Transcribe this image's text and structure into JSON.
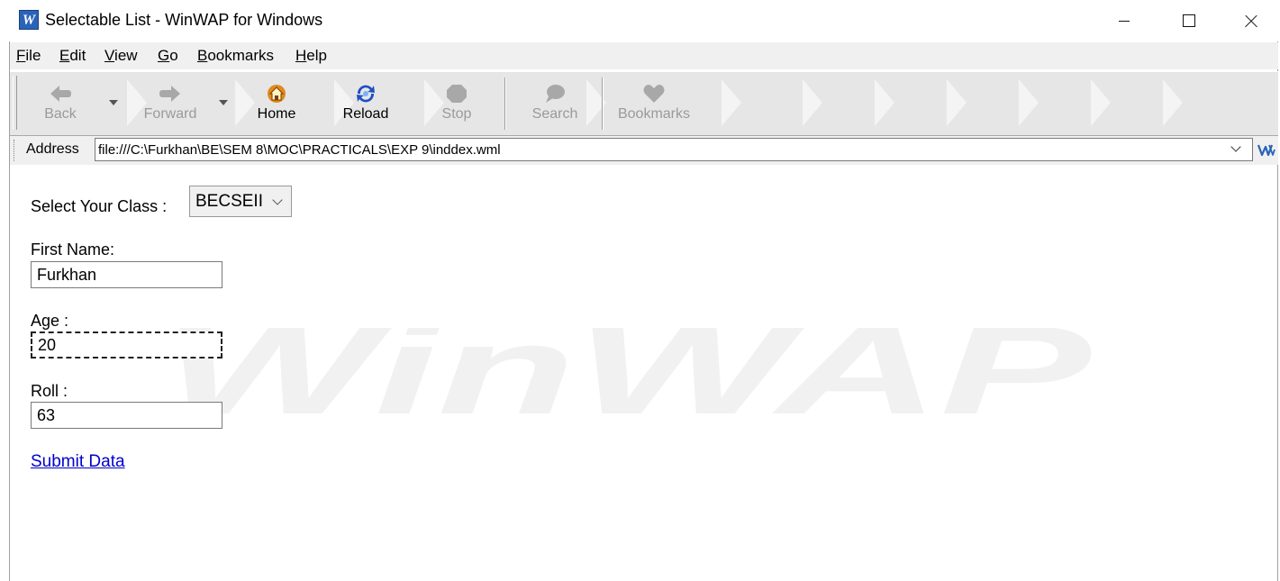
{
  "window": {
    "title": "Selectable List - WinWAP for Windows",
    "icon_letter": "W"
  },
  "menu": [
    {
      "label": "File",
      "key": "F",
      "rest": "ile"
    },
    {
      "label": "Edit",
      "key": "E",
      "rest": "dit"
    },
    {
      "label": "View",
      "key": "V",
      "rest": "iew"
    },
    {
      "label": "Go",
      "key": "G",
      "rest": "o"
    },
    {
      "label": "Bookmarks",
      "key": "B",
      "rest": "ookmarks"
    },
    {
      "label": "Help",
      "key": "H",
      "rest": "elp"
    }
  ],
  "toolbar": {
    "back": "Back",
    "forward": "Forward",
    "home": "Home",
    "reload": "Reload",
    "stop": "Stop",
    "search": "Search",
    "bookmarks": "Bookmarks"
  },
  "address": {
    "label": "Address",
    "value": "file:///C:\\Furkhan\\BE\\SEM 8\\MOC\\PRACTICALS\\EXP 9\\inddex.wml"
  },
  "form": {
    "class_label": "Select Your Class :",
    "class_value": "BECSEII",
    "first_name_label": "First Name:",
    "first_name_value": "Furkhan",
    "age_label": "Age :",
    "age_value": "20",
    "roll_label": "Roll :",
    "roll_value": "63",
    "submit_link": "Submit Data"
  },
  "watermark_text": "WinWAP",
  "colors": {
    "link": "#0000cc",
    "icon_blue": "#2a63b8",
    "toolbar_bg": "#e6e6e6"
  }
}
